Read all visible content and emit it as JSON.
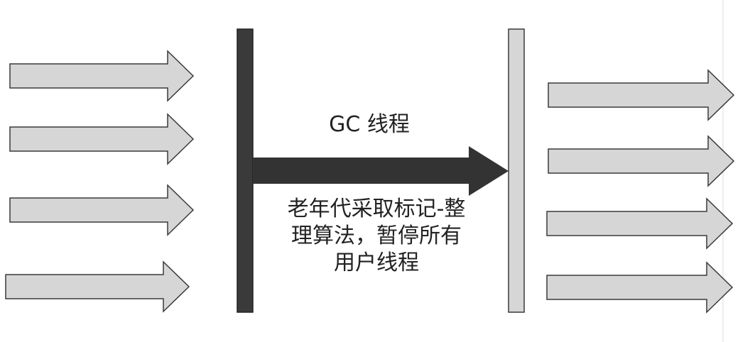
{
  "diagram": {
    "gc_thread_label": "GC 线程",
    "description_lines": [
      "老年代采取标记-整",
      "理算法，暂停所有",
      "用户线程"
    ]
  },
  "colors": {
    "user_arrow_fill": "#d6d6d6",
    "user_arrow_stroke": "#3a3a3a",
    "gc_arrow_fill": "#333333",
    "pause_bar_start_fill": "#3a3a3a",
    "pause_bar_end_fill": "#d6d6d6",
    "background": "#ffffff"
  },
  "icons": {
    "user_thread_arrow": "right-arrow-icon",
    "gc_thread_arrow": "right-arrow-icon"
  }
}
